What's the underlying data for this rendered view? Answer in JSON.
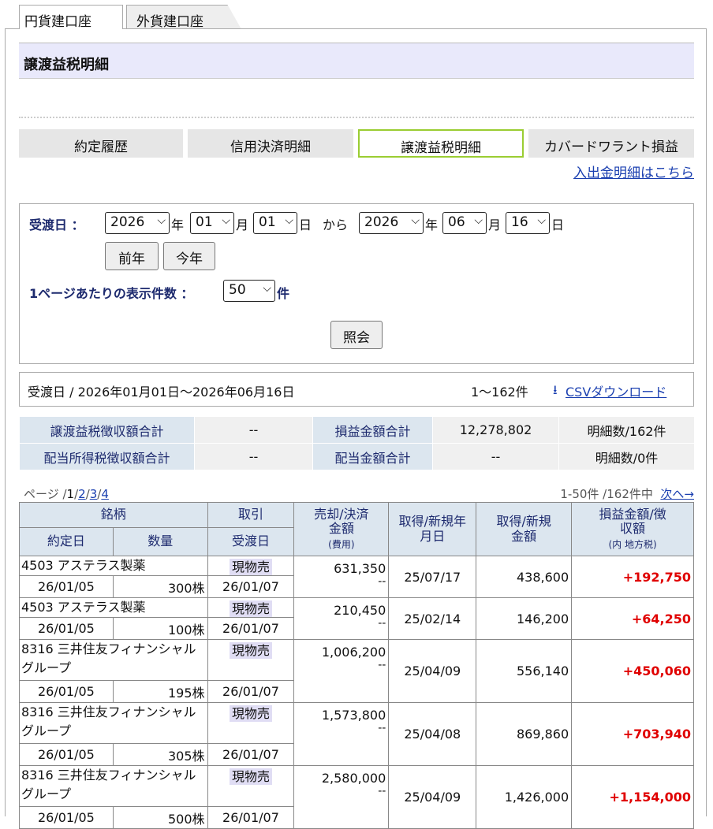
{
  "tabs": {
    "yen": "円貨建口座",
    "fx": "外貨建口座"
  },
  "title": "譲渡益税明細",
  "nav": [
    "約定履歴",
    "信用決済明細",
    "譲渡益税明細",
    "カバードワラント損益"
  ],
  "nav_link": "入出金明細はこちら",
  "form": {
    "date_label": "受渡日 ：",
    "from_year": "2026",
    "from_month": "01",
    "from_day": "01",
    "to_year": "2026",
    "to_month": "06",
    "to_day": "16",
    "year_suffix": "年",
    "month_suffix": "月",
    "day_suffix": "日",
    "from_text": "から",
    "prev_year": "前年",
    "this_year": "今年",
    "per_page_label": "1ページあたりの表示件数 ：",
    "per_page": "50",
    "per_page_suffix": "件",
    "submit": "照会"
  },
  "range": {
    "text": "受渡日 / 2026年01月01日〜2026年06月16日",
    "count": "1〜162件",
    "csv": "CSVダウンロード"
  },
  "summary": [
    [
      "譲渡益税徴収額合計",
      "--",
      "損益金額合計",
      "12,278,802",
      "明細数/162件"
    ],
    [
      "配当所得税徴収額合計",
      "--",
      "配当金額合計",
      "--",
      "明細数/0件"
    ]
  ],
  "pager": {
    "label": "ページ /",
    "current": "1",
    "pages": [
      "2",
      "3",
      "4"
    ],
    "right": "1-50件 /162件中",
    "next": "次へ→"
  },
  "headers": {
    "stock": "銘柄",
    "trade": "取引",
    "sell": "売却/決済金額",
    "fee": "(費用)",
    "acq_date": "取得/新規年月日",
    "acq_amt": "取得/新規金額",
    "pl": "損益金額/徴収額",
    "pl_sub": "(内 地方税)",
    "trade_date": "約定日",
    "qty": "数量",
    "settle": "受渡日"
  },
  "rows": [
    {
      "name": "4503 アステラス製薬",
      "type": "現物売",
      "sell": "631,350",
      "fee": "--",
      "acq_date": "25/07/17",
      "acq_amt": "438,600",
      "pl": "+192,750",
      "trade_date": "26/01/05",
      "qty": "300株",
      "settle": "26/01/07"
    },
    {
      "name": "4503 アステラス製薬",
      "type": "現物売",
      "sell": "210,450",
      "fee": "--",
      "acq_date": "25/02/14",
      "acq_amt": "146,200",
      "pl": "+64,250",
      "trade_date": "26/01/05",
      "qty": "100株",
      "settle": "26/01/07"
    },
    {
      "name": "8316 三井住友フィナンシャルグループ",
      "type": "現物売",
      "sell": "1,006,200",
      "fee": "--",
      "acq_date": "25/04/09",
      "acq_amt": "556,140",
      "pl": "+450,060",
      "trade_date": "26/01/05",
      "qty": "195株",
      "settle": "26/01/07"
    },
    {
      "name": "8316 三井住友フィナンシャルグループ",
      "type": "現物売",
      "sell": "1,573,800",
      "fee": "--",
      "acq_date": "25/04/08",
      "acq_amt": "869,860",
      "pl": "+703,940",
      "trade_date": "26/01/05",
      "qty": "305株",
      "settle": "26/01/07"
    },
    {
      "name": "8316 三井住友フィナンシャルグループ",
      "type": "現物売",
      "sell": "2,580,000",
      "fee": "--",
      "acq_date": "25/04/09",
      "acq_amt": "1,426,000",
      "pl": "+1,154,000",
      "trade_date": "26/01/05",
      "qty": "500株",
      "settle": "26/01/07"
    }
  ]
}
